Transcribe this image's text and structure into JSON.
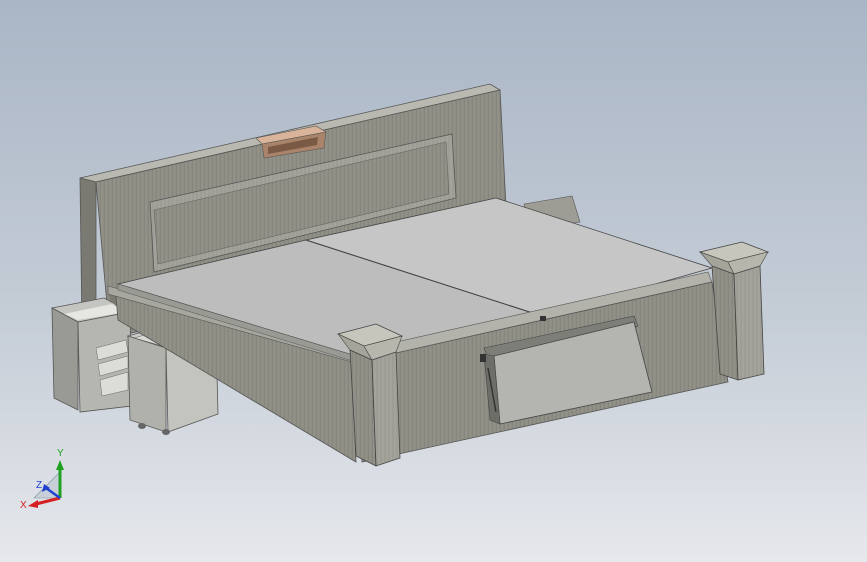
{
  "triad": {
    "x_label": "X",
    "y_label": "Y",
    "z_label": "Z",
    "x_color": "#d42020",
    "y_color": "#20a020",
    "z_color": "#2040d0"
  },
  "colors": {
    "background_top": "#aab6c6",
    "background_bottom": "#e6e8ec",
    "wood": "#8d8d84",
    "wood_light": "#a9a9a1",
    "wood_dark": "#6e6e66",
    "mattress": "#bdbdbd",
    "name_plate": "#c9a48a"
  }
}
